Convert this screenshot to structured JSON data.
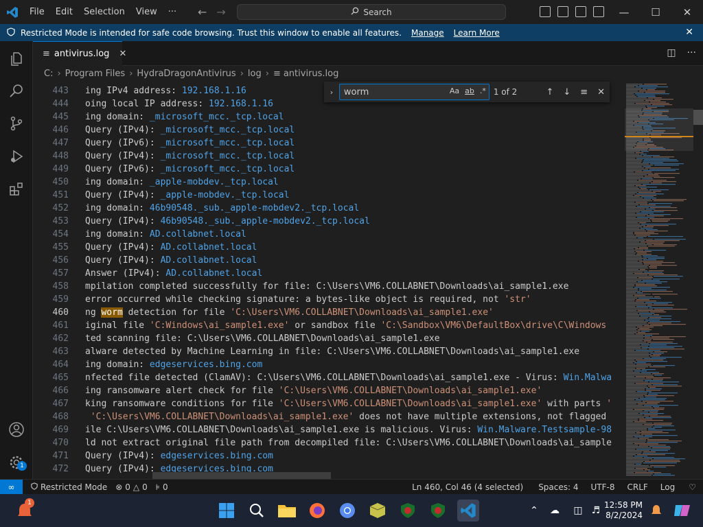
{
  "titlebar": {
    "menu": [
      "File",
      "Edit",
      "Selection",
      "View",
      "···"
    ],
    "search_label": "Search"
  },
  "banner": {
    "message": "Restricted Mode is intended for safe code browsing. Trust this window to enable all features.",
    "manage": "Manage",
    "learn_more": "Learn More"
  },
  "tab": {
    "label": "antivirus.log"
  },
  "breadcrumb": [
    "C:",
    "Program Files",
    "HydraDragonAntivirus",
    "log",
    "antivirus.log"
  ],
  "find": {
    "value": "worm",
    "match_case": "Aa",
    "whole_word": "ab",
    "regex": ".*",
    "count": "1 of 2"
  },
  "lines": [
    {
      "n": "443",
      "parts": [
        [
          "",
          "ing IPv4 address: "
        ],
        [
          "s",
          "192.168.1.16"
        ]
      ]
    },
    {
      "n": "444",
      "parts": [
        [
          "",
          "oing local IP address: "
        ],
        [
          "s",
          "192.168.1.16"
        ]
      ]
    },
    {
      "n": "445",
      "parts": [
        [
          "",
          "ing domain: "
        ],
        [
          "s",
          "_microsoft_mcc._tcp.local"
        ]
      ]
    },
    {
      "n": "446",
      "parts": [
        [
          "",
          "Query (IPv4): "
        ],
        [
          "s",
          "_microsoft_mcc._tcp.local"
        ]
      ]
    },
    {
      "n": "447",
      "parts": [
        [
          "",
          "Query (IPv6): "
        ],
        [
          "s",
          "_microsoft_mcc._tcp.local"
        ]
      ]
    },
    {
      "n": "448",
      "parts": [
        [
          "",
          "Query (IPv4): "
        ],
        [
          "s",
          "_microsoft_mcc._tcp.local"
        ]
      ]
    },
    {
      "n": "449",
      "parts": [
        [
          "",
          "Query (IPv6): "
        ],
        [
          "s",
          "_microsoft_mcc._tcp.local"
        ]
      ]
    },
    {
      "n": "450",
      "parts": [
        [
          "",
          "ing domain: "
        ],
        [
          "s",
          "_apple-mobdev._tcp.local"
        ]
      ]
    },
    {
      "n": "451",
      "parts": [
        [
          "",
          "Query (IPv4): "
        ],
        [
          "s",
          "_apple-mobdev._tcp.local"
        ]
      ]
    },
    {
      "n": "452",
      "parts": [
        [
          "",
          "ing domain: "
        ],
        [
          "s",
          "46b90548._sub._apple-mobdev2._tcp.local"
        ]
      ]
    },
    {
      "n": "453",
      "parts": [
        [
          "",
          "Query (IPv4): "
        ],
        [
          "s",
          "46b90548._sub._apple-mobdev2._tcp.local"
        ]
      ]
    },
    {
      "n": "454",
      "parts": [
        [
          "",
          "ing domain: "
        ],
        [
          "s",
          "AD.collabnet.local"
        ]
      ]
    },
    {
      "n": "455",
      "parts": [
        [
          "",
          "Query (IPv4): "
        ],
        [
          "s",
          "AD.collabnet.local"
        ]
      ]
    },
    {
      "n": "456",
      "parts": [
        [
          "",
          "Query (IPv4): "
        ],
        [
          "s",
          "AD.collabnet.local"
        ]
      ]
    },
    {
      "n": "457",
      "parts": [
        [
          "",
          "Answer (IPv4): "
        ],
        [
          "s",
          "AD.collabnet.local"
        ]
      ]
    },
    {
      "n": "458",
      "parts": [
        [
          "",
          "mpilation completed successfully for file: C:\\Users\\VM6.COLLABNET\\Downloads\\ai_sample1.exe"
        ]
      ]
    },
    {
      "n": "459",
      "parts": [
        [
          "",
          "error occurred while checking signature: a bytes-like object is required, not "
        ],
        [
          "q",
          "'str'"
        ]
      ]
    },
    {
      "n": "460",
      "cur": true,
      "parts": [
        [
          "",
          "ng "
        ],
        [
          "hl",
          "worm"
        ],
        [
          "",
          " detection for file "
        ],
        [
          "q",
          "'C:\\Users\\VM6.COLLABNET\\Downloads\\ai_sample1.exe'"
        ]
      ]
    },
    {
      "n": "461",
      "parts": [
        [
          "",
          "iginal file "
        ],
        [
          "q",
          "'C:Windows\\ai_sample1.exe'"
        ],
        [
          "",
          " or sandbox file "
        ],
        [
          "q",
          "'C:\\Sandbox\\VM6\\DefaultBox\\drive\\C\\Windows"
        ]
      ]
    },
    {
      "n": "462",
      "parts": [
        [
          "",
          "ted scanning file: C:\\Users\\VM6.COLLABNET\\Downloads\\ai_sample1.exe"
        ]
      ]
    },
    {
      "n": "463",
      "parts": [
        [
          "",
          "alware detected by Machine Learning in file: C:\\Users\\VM6.COLLABNET\\Downloads\\ai_sample1.exe"
        ]
      ]
    },
    {
      "n": "464",
      "parts": [
        [
          "",
          "ing domain: "
        ],
        [
          "s",
          "edgeservices.bing.com"
        ]
      ]
    },
    {
      "n": "465",
      "parts": [
        [
          "",
          "nfected file detected (ClamAV): C:\\Users\\VM6.COLLABNET\\Downloads\\ai_sample1.exe - Virus: "
        ],
        [
          "s",
          "Win.Malwa"
        ]
      ]
    },
    {
      "n": "466",
      "parts": [
        [
          "",
          "ing ransomware alert check for file "
        ],
        [
          "q",
          "'C:\\Users\\VM6.COLLABNET\\Downloads\\ai_sample1.exe'"
        ]
      ]
    },
    {
      "n": "467",
      "parts": [
        [
          "",
          "king ransomware conditions for file "
        ],
        [
          "q",
          "'C:\\Users\\VM6.COLLABNET\\Downloads\\ai_sample1.exe'"
        ],
        [
          "",
          " with parts "
        ],
        [
          "q",
          "'"
        ]
      ]
    },
    {
      "n": "468",
      "parts": [
        [
          "",
          " "
        ],
        [
          "q",
          "'C:\\Users\\VM6.COLLABNET\\Downloads\\ai_sample1.exe'"
        ],
        [
          "",
          " does not have multiple extensions, not flagged"
        ]
      ]
    },
    {
      "n": "469",
      "parts": [
        [
          "",
          "ile C:\\Users\\VM6.COLLABNET\\Downloads\\ai_sample1.exe is malicious. Virus: "
        ],
        [
          "s",
          "Win.Malware.Testsample-98"
        ]
      ]
    },
    {
      "n": "470",
      "parts": [
        [
          "",
          "ld not extract original file path from decompiled file: C:\\Users\\VM6.COLLABNET\\Downloads\\ai_sample"
        ]
      ]
    },
    {
      "n": "471",
      "parts": [
        [
          "",
          "Query (IPv4): "
        ],
        [
          "s",
          "edgeservices.bing.com"
        ]
      ]
    },
    {
      "n": "472",
      "parts": [
        [
          "",
          "Query (IPv4): "
        ],
        [
          "s",
          "edgeservices.bing.com"
        ]
      ]
    }
  ],
  "status": {
    "restricted": "Restricted Mode",
    "errors": "0",
    "warnings": "0",
    "ports": "0",
    "position": "Ln 460, Col 46 (4 selected)",
    "spaces": "Spaces: 4",
    "encoding": "UTF-8",
    "eol": "CRLF",
    "language": "Log"
  },
  "activity": {
    "badge": "1"
  },
  "taskbar": {
    "time": "12:58 PM",
    "date": "8/2/2024",
    "badge": "1"
  },
  "colors": {
    "accent": "#0078d4",
    "banner": "#0e3e64",
    "string": "#4fa3e8",
    "quote": "#ce9178",
    "match": "#8a5a00"
  }
}
